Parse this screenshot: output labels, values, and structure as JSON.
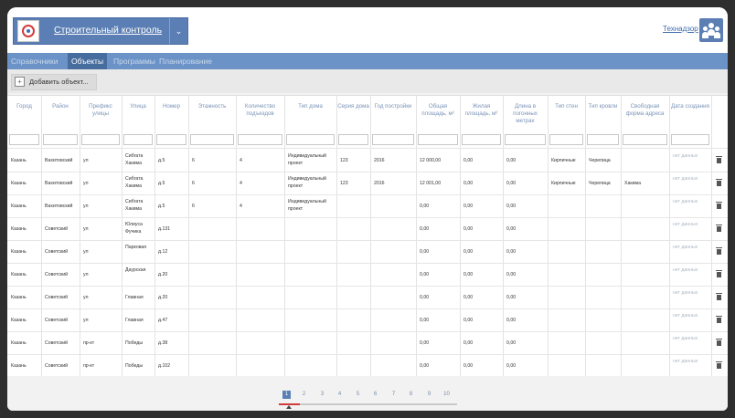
{
  "app": {
    "title": "Строительный контроль",
    "user": "Технадзор",
    "brand_color": "#5b7fb4"
  },
  "nav": {
    "tabs": [
      {
        "label": "Справочники",
        "active": false
      },
      {
        "label": "Объекты",
        "active": true
      },
      {
        "label": "Программы",
        "active": false
      },
      {
        "label": "Планирование",
        "active": false
      }
    ]
  },
  "toolbar": {
    "add_label": "Добавить объект..."
  },
  "table": {
    "columns": [
      "Город",
      "Район",
      "Префикс улицы",
      "Улица",
      "Номер",
      "Этажность",
      "Количество подъездов",
      "Тип дома",
      "Серия дома",
      "Год постройки",
      "Общая площадь, м²",
      "Жилая площадь, м²",
      "Длина в погонных метрах",
      "Тип стен",
      "Тип кровли",
      "Свободная форма адреса",
      "Дата создания"
    ],
    "rows": [
      [
        "Казань",
        "Вахитовский",
        "ул",
        "Сибгата Хакима",
        "д.5",
        "6",
        "4",
        "Индивидуальный проект",
        "123",
        "2016",
        "12 000,00",
        "0,00",
        "0,00",
        "Кирпичные",
        "Черепица",
        "",
        "нет данных"
      ],
      [
        "Казань",
        "Вахитовский",
        "ул",
        "Сибгата Хакима",
        "д.5",
        "6",
        "4",
        "Индивидуальный проект",
        "123",
        "2016",
        "12 001,00",
        "0,00",
        "0,00",
        "Кирпичные",
        "Черепица",
        "Хакима",
        "нет данных"
      ],
      [
        "Казань",
        "Вахитовский",
        "ул",
        "Сибгата Хакима",
        "д.5",
        "6",
        "4",
        "Индивидуальный проект",
        "",
        "",
        "0,00",
        "0,00",
        "0,00",
        "",
        "",
        "",
        "нет данных"
      ],
      [
        "Казань",
        "Советский",
        "ул",
        "Юлиуса Фучика",
        "д.131",
        "",
        "",
        "",
        "",
        "",
        "0,00",
        "0,00",
        "0,00",
        "",
        "",
        "",
        "нет данных"
      ],
      [
        "Казань",
        "Советский",
        "ул",
        "Парковая",
        "д.12",
        "",
        "",
        "",
        "",
        "",
        "0,00",
        "0,00",
        "0,00",
        "",
        "",
        "",
        "нет данных"
      ],
      [
        "Казань",
        "Советский",
        "ул",
        "Даурская",
        "д.20",
        "",
        "",
        "",
        "",
        "",
        "0,00",
        "0,00",
        "0,00",
        "",
        "",
        "",
        "нет данных"
      ],
      [
        "Казань",
        "Советский",
        "ул",
        "Главная",
        "д.20",
        "",
        "",
        "",
        "",
        "",
        "0,00",
        "0,00",
        "0,00",
        "",
        "",
        "",
        "нет данных"
      ],
      [
        "Казань",
        "Советский",
        "ул",
        "Главная",
        "д.47",
        "",
        "",
        "",
        "",
        "",
        "0,00",
        "0,00",
        "0,00",
        "",
        "",
        "",
        "нет данных"
      ],
      [
        "Казань",
        "Советский",
        "пр-кт",
        "Победы",
        "д.38",
        "",
        "",
        "",
        "",
        "",
        "0,00",
        "0,00",
        "0,00",
        "",
        "",
        "",
        "нет данных"
      ],
      [
        "Казань",
        "Советский",
        "пр-кт",
        "Победы",
        "д.102",
        "",
        "",
        "",
        "",
        "",
        "0,00",
        "0,00",
        "0,00",
        "",
        "",
        "",
        "нет данных"
      ]
    ]
  },
  "pagination": {
    "pages": [
      "1",
      "2",
      "3",
      "4",
      "5",
      "6",
      "7",
      "8",
      "9",
      "10"
    ],
    "current": "1",
    "progress": 0.12
  }
}
